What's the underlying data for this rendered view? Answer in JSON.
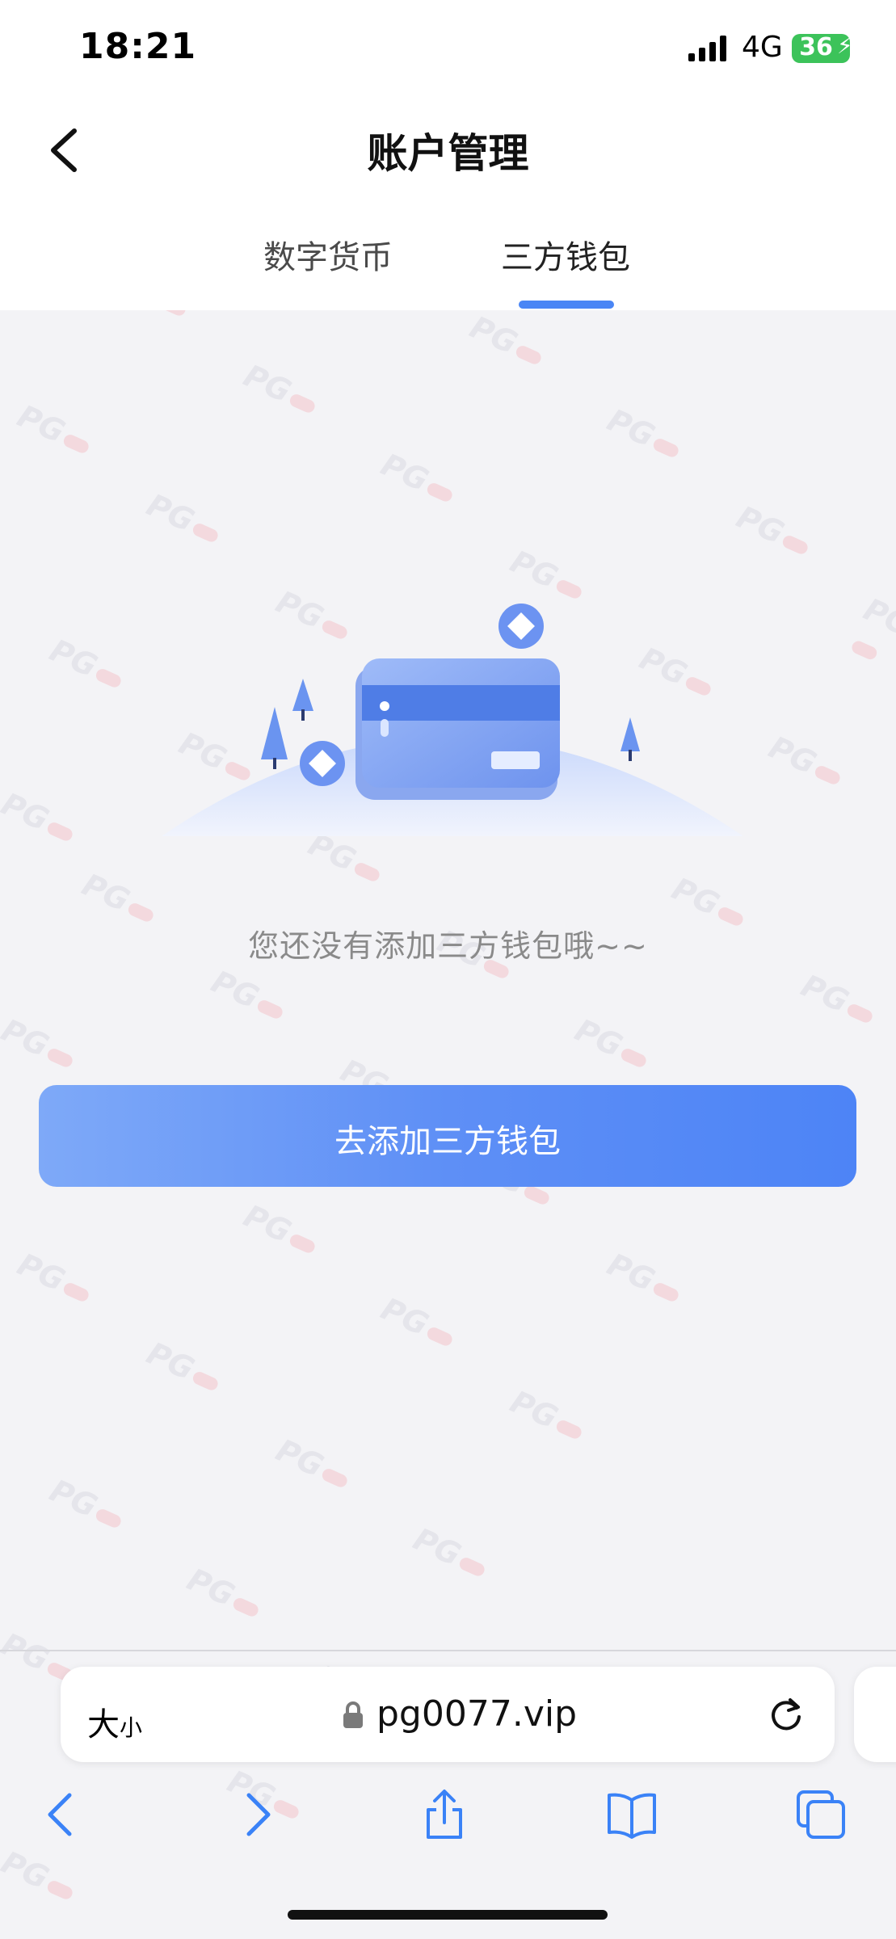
{
  "status_bar": {
    "time": "18:21",
    "network": "4G",
    "battery": "36"
  },
  "header": {
    "title": "账户管理"
  },
  "tabs": [
    {
      "label": "数字货币",
      "active": false
    },
    {
      "label": "三方钱包",
      "active": true
    }
  ],
  "empty_state": {
    "message": "您还没有添加三方钱包哦~~"
  },
  "primary_button": {
    "label": "去添加三方钱包"
  },
  "browser": {
    "text_size_label": "大",
    "text_size_small": "小",
    "url": "pg0077.vip"
  },
  "watermark": {
    "text": "PG"
  },
  "colors": {
    "accent": "#4a86f5",
    "button_start": "#7ea9f8",
    "button_end": "#4d84f6",
    "background": "#f3f3f6"
  }
}
